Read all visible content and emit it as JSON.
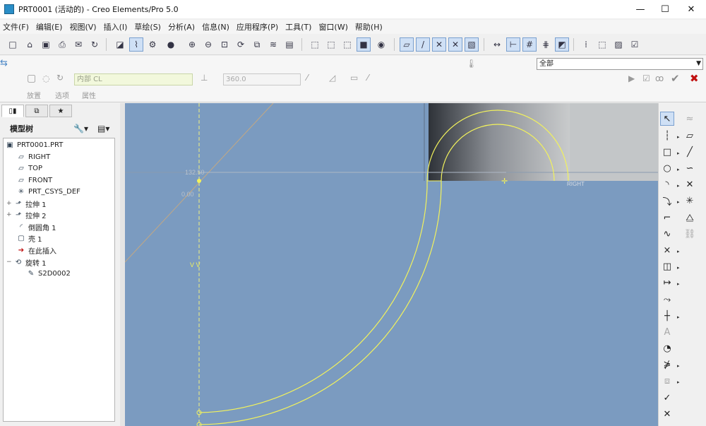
{
  "window": {
    "title": "PRT0001 (活动的) - Creo Elements/Pro 5.0",
    "minimize": "—",
    "maximize": "☐",
    "close": "✕"
  },
  "menu": [
    "文件(F)",
    "编辑(E)",
    "视图(V)",
    "插入(I)",
    "草绘(S)",
    "分析(A)",
    "信息(N)",
    "应用程序(P)",
    "工具(T)",
    "窗口(W)",
    "帮助(H)"
  ],
  "dashboard": {
    "section_field": "内部 CL",
    "angle_value": "360.0",
    "labels": [
      "放置",
      "选项",
      "属性"
    ],
    "filter_value": "全部"
  },
  "model_tree": {
    "header": "模型树",
    "nodes": [
      {
        "label": "PRT0001.PRT",
        "icon": "part-icon"
      },
      {
        "label": "RIGHT",
        "icon": "datum-plane-icon"
      },
      {
        "label": "TOP",
        "icon": "datum-plane-icon"
      },
      {
        "label": "FRONT",
        "icon": "datum-plane-icon"
      },
      {
        "label": "PRT_CSYS_DEF",
        "icon": "csys-icon"
      },
      {
        "label": "拉伸 1",
        "icon": "extrude-icon"
      },
      {
        "label": "拉伸 2",
        "icon": "extrude-icon"
      },
      {
        "label": "倒圆角 1",
        "icon": "round-icon"
      },
      {
        "label": "壳 1",
        "icon": "shell-icon"
      },
      {
        "label": "在此插入",
        "icon": "insert-here-icon"
      },
      {
        "label": "旋转 1",
        "icon": "revolve-icon"
      },
      {
        "label": "S2D0002",
        "icon": "sketch-icon"
      }
    ]
  },
  "sketch": {
    "dimension_1": "132.50",
    "dimension_2": "0.00",
    "constraint_label": "V V",
    "reference_label": "RIGHT"
  },
  "colors": {
    "canvas": "#7b9bc0",
    "sketch_line": "#f2f25c",
    "accent": "#2a8ec7"
  }
}
